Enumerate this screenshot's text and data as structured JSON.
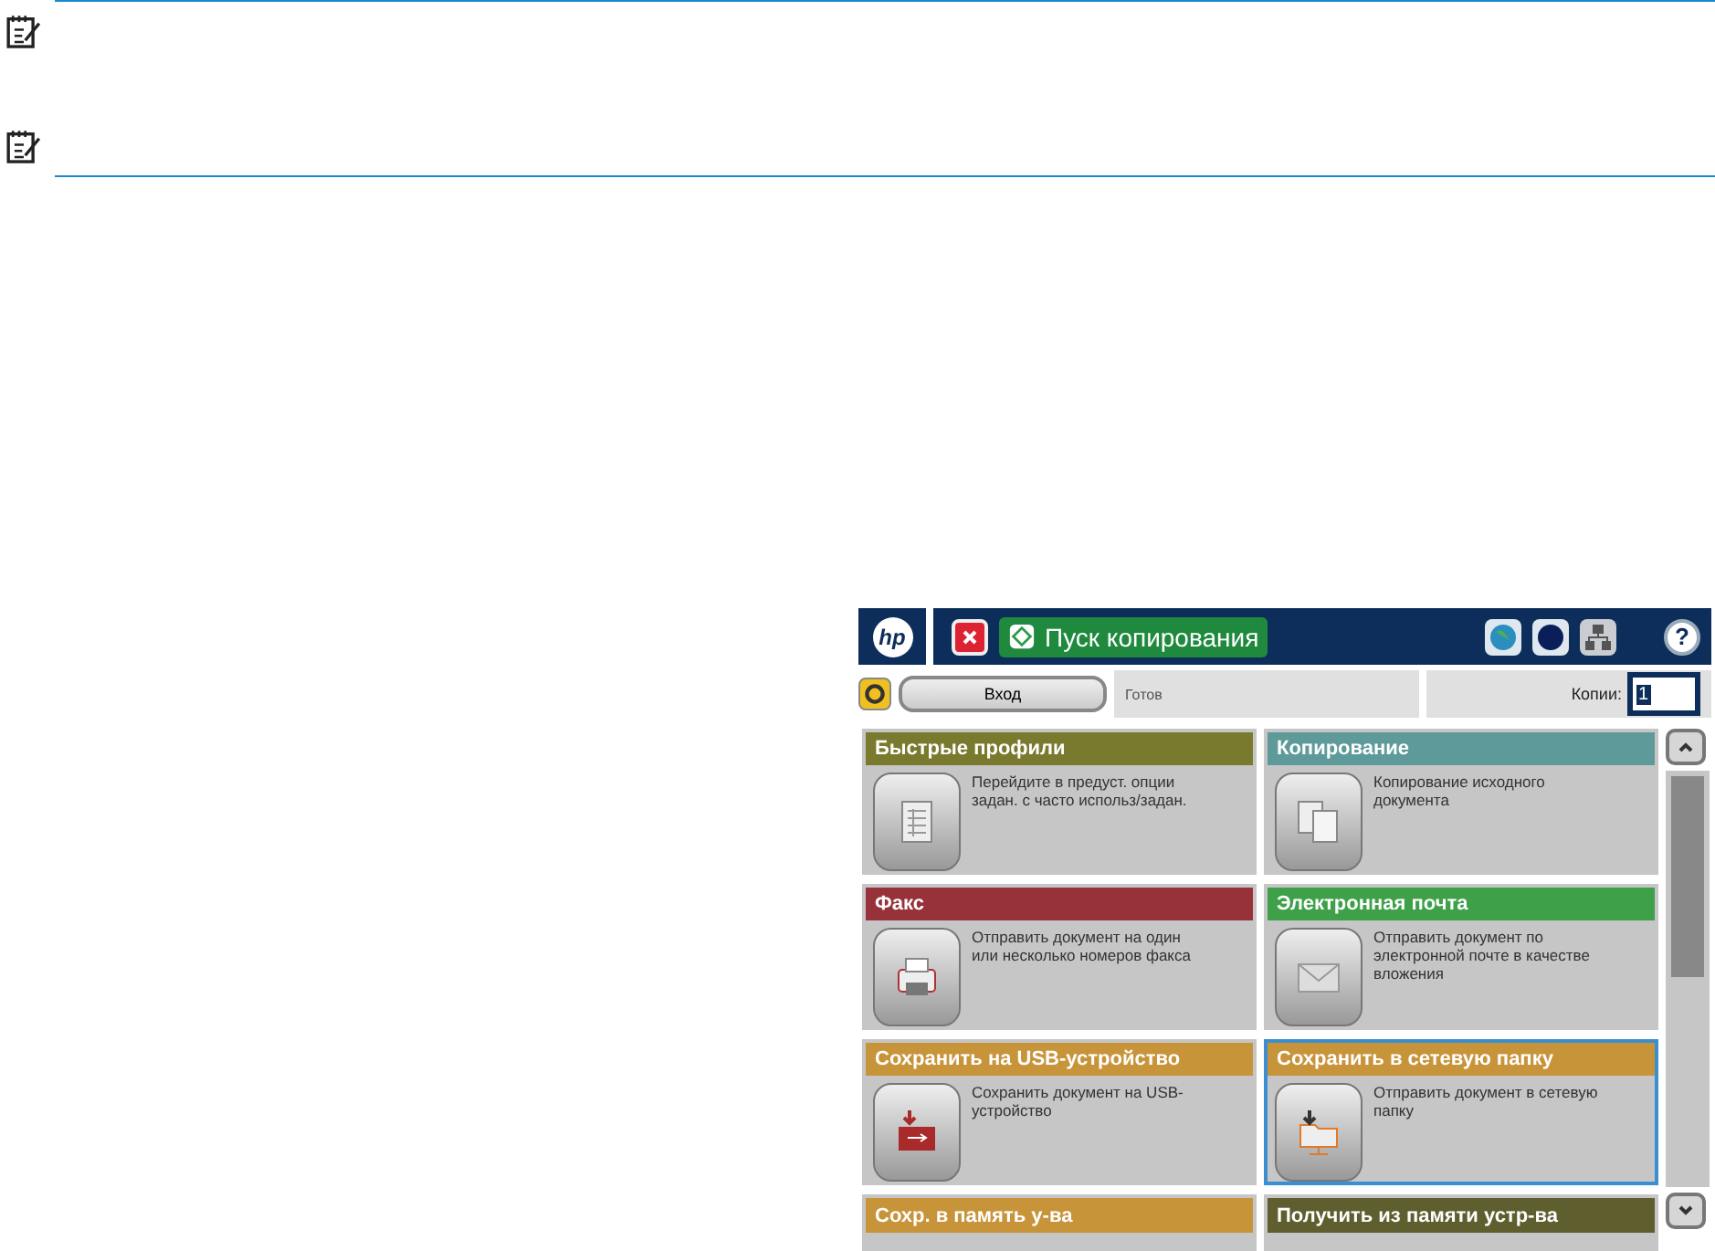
{
  "panel": {
    "logo": "hp",
    "start_button": "Пуск копирования",
    "help": "?",
    "sign_in_button": "Вход",
    "status": "Готов",
    "copies_label": "Копии:",
    "copies_value": "1"
  },
  "tiles": [
    {
      "title": "Быстрые профили",
      "description": "Перейдите в предуст. опции задан. с часто использ/задан.",
      "color": "#7a7a2e",
      "kind": "profiles",
      "selected": false
    },
    {
      "title": "Копирование",
      "description": "Копирование исходного документа",
      "color": "#5e9a9a",
      "kind": "copy",
      "selected": false
    },
    {
      "title": "Факс",
      "description": "Отправить документ на один или несколько номеров факса",
      "color": "#98323a",
      "kind": "fax",
      "selected": false
    },
    {
      "title": "Электронная почта",
      "description": "Отправить документ по электронной почте в качестве вложения",
      "color": "#3fa04a",
      "kind": "email",
      "selected": false
    },
    {
      "title": "Сохранить на USB-устройство",
      "description": "Сохранить документ на USB-устройство",
      "color": "#c8943a",
      "kind": "usb",
      "selected": false
    },
    {
      "title": "Сохранить в сетевую папку",
      "description": "Отправить документ в сетевую папку",
      "color": "#c8943a",
      "kind": "folder",
      "selected": true
    },
    {
      "title": "Сохр. в память у-ва",
      "color": "#c8943a",
      "kind": "partial",
      "selected": false
    },
    {
      "title": "Получить из памяти устр-ва",
      "color": "#5e5e2e",
      "kind": "partial",
      "selected": false
    }
  ]
}
